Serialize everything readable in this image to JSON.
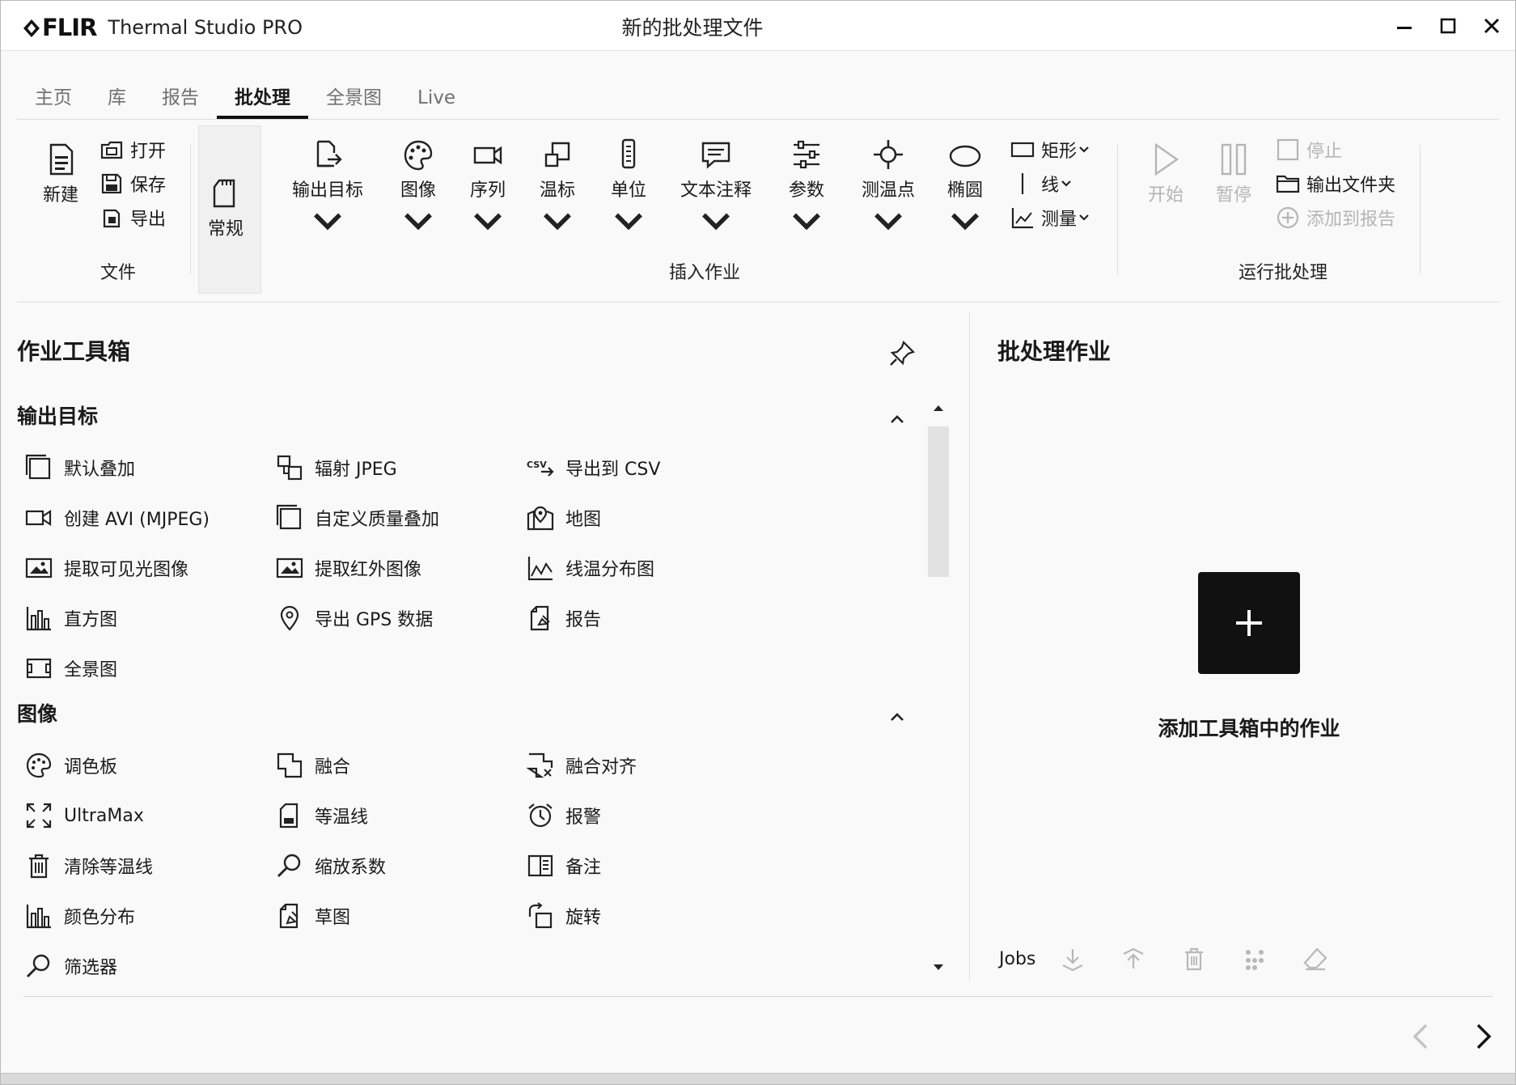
{
  "app": {
    "logo": "FLIR",
    "name": "Thermal Studio PRO",
    "document_title": "新的批处理文件"
  },
  "tabs": [
    {
      "label": "主页",
      "active": false
    },
    {
      "label": "库",
      "active": false
    },
    {
      "label": "报告",
      "active": false
    },
    {
      "label": "批处理",
      "active": true
    },
    {
      "label": "全景图",
      "active": false
    },
    {
      "label": "Live",
      "active": false
    }
  ],
  "ribbon": {
    "file": {
      "group_label": "文件",
      "new": "新建",
      "open": "打开",
      "save": "保存",
      "export": "导出"
    },
    "normal": "常规",
    "insert": {
      "group_label": "插入作业",
      "output_target": "输出目标",
      "image": "图像",
      "sequence": "序列",
      "scale": "温标",
      "unit": "单位",
      "text_annotation": "文本注释",
      "parameters": "参数",
      "spot": "测温点",
      "ellipse": "椭圆",
      "rectangle": "矩形",
      "line": "线",
      "measure": "测量"
    },
    "run": {
      "group_label": "运行批处理",
      "start": "开始",
      "pause": "暂停",
      "stop": "停止",
      "output_folder": "输出文件夹",
      "add_to_report": "添加到报告"
    }
  },
  "toolbox": {
    "title": "作业工具箱",
    "sections": [
      {
        "title": "输出目标",
        "items": [
          {
            "label": "默认叠加",
            "icon": "overlay-icon"
          },
          {
            "label": "辐射 JPEG",
            "icon": "radiometric-jpeg-icon"
          },
          {
            "label": "导出到 CSV",
            "icon": "csv-icon"
          },
          {
            "label": "创建 AVI (MJPEG)",
            "icon": "video-icon"
          },
          {
            "label": "自定义质量叠加",
            "icon": "overlay-icon"
          },
          {
            "label": "地图",
            "icon": "map-icon"
          },
          {
            "label": "提取可见光图像",
            "icon": "image-icon"
          },
          {
            "label": "提取红外图像",
            "icon": "image-icon"
          },
          {
            "label": "线温分布图",
            "icon": "line-chart-icon"
          },
          {
            "label": "直方图",
            "icon": "histogram-icon"
          },
          {
            "label": "导出 GPS 数据",
            "icon": "location-pin-icon"
          },
          {
            "label": "报告",
            "icon": "report-icon"
          },
          {
            "label": "全景图",
            "icon": "panorama-icon"
          }
        ]
      },
      {
        "title": "图像",
        "items": [
          {
            "label": "调色板",
            "icon": "palette-icon"
          },
          {
            "label": "融合",
            "icon": "fusion-icon"
          },
          {
            "label": "融合对齐",
            "icon": "fusion-align-icon"
          },
          {
            "label": "UltraMax",
            "icon": "expand-icon"
          },
          {
            "label": "等温线",
            "icon": "isotherm-icon"
          },
          {
            "label": "报警",
            "icon": "alarm-icon"
          },
          {
            "label": "清除等温线",
            "icon": "trash-icon"
          },
          {
            "label": "缩放系数",
            "icon": "zoom-icon"
          },
          {
            "label": "备注",
            "icon": "notes-icon"
          },
          {
            "label": "颜色分布",
            "icon": "histogram-icon"
          },
          {
            "label": "草图",
            "icon": "sketch-icon"
          },
          {
            "label": "旋转",
            "icon": "rotate-icon"
          },
          {
            "label": "筛选器",
            "icon": "filter-icon"
          }
        ]
      }
    ]
  },
  "batch": {
    "title": "批处理作业",
    "add_label": "添加工具箱中的作业",
    "jobs_label": "Jobs"
  }
}
